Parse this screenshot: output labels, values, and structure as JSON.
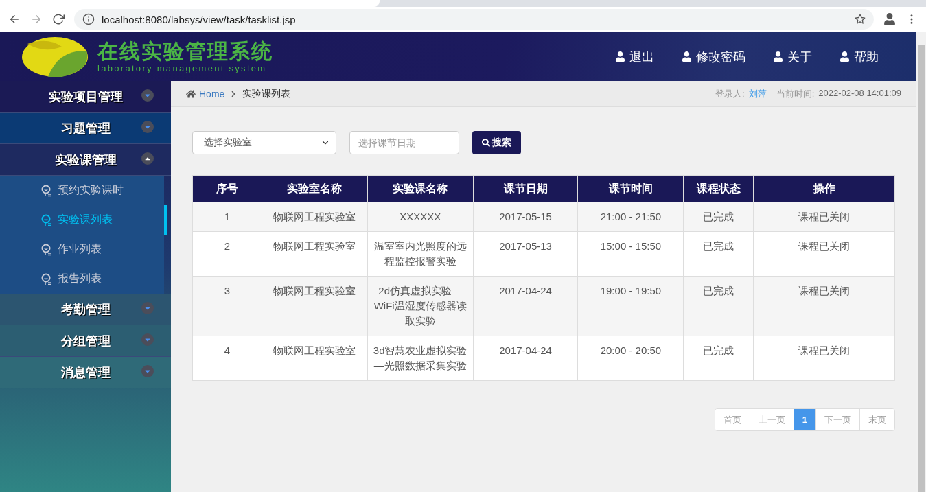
{
  "browser": {
    "url": "localhost:8080/labsys/view/task/tasklist.jsp"
  },
  "header": {
    "logo_title": "在线实验管理系统",
    "logo_subtitle": "laboratory management system",
    "links": [
      {
        "label": "退出"
      },
      {
        "label": "修改密码"
      },
      {
        "label": "关于"
      },
      {
        "label": "帮助"
      }
    ]
  },
  "sidebar": {
    "groups": [
      {
        "label": "实验项目管理",
        "expanded": false
      },
      {
        "label": "习题管理",
        "expanded": false
      },
      {
        "label": "实验课管理",
        "expanded": true,
        "children": [
          {
            "label": "预约实验课时",
            "selected": false
          },
          {
            "label": "实验课列表",
            "selected": true
          },
          {
            "label": "作业列表",
            "selected": false
          },
          {
            "label": "报告列表",
            "selected": false
          }
        ]
      },
      {
        "label": "考勤管理",
        "expanded": false
      },
      {
        "label": "分组管理",
        "expanded": false
      },
      {
        "label": "消息管理",
        "expanded": false
      }
    ]
  },
  "breadcrumb": {
    "home": "Home",
    "current": "实验课列表",
    "user_label": "登录人:",
    "user": "刘萍",
    "time_label": "当前时间:",
    "time": "2022-02-08 14:01:09"
  },
  "filters": {
    "lab_select": "选择实验室",
    "date_placeholder": "选择课节日期",
    "search_button": "搜索"
  },
  "table": {
    "columns": [
      "序号",
      "实验室名称",
      "实验课名称",
      "课节日期",
      "课节时间",
      "课程状态",
      "操作"
    ],
    "rows": [
      [
        "1",
        "物联网工程实验室",
        "XXXXXX",
        "2017-05-15",
        "21:00 - 21:50",
        "已完成",
        "课程已关闭"
      ],
      [
        "2",
        "物联网工程实验室",
        "温室室内光照度的远程监控报警实验",
        "2017-05-13",
        "15:00 - 15:50",
        "已完成",
        "课程已关闭"
      ],
      [
        "3",
        "物联网工程实验室",
        "2d仿真虚拟实验—WiFi温湿度传感器读取实验",
        "2017-04-24",
        "19:00 - 19:50",
        "已完成",
        "课程已关闭"
      ],
      [
        "4",
        "物联网工程实验室",
        "3d智慧农业虚拟实验—光照数据采集实验",
        "2017-04-24",
        "20:00 - 20:50",
        "已完成",
        "课程已关闭"
      ]
    ]
  },
  "pagination": [
    {
      "label": "首页",
      "selected": false
    },
    {
      "label": "上一页",
      "selected": false
    },
    {
      "label": "1",
      "selected": true
    },
    {
      "label": "下一页",
      "selected": false
    },
    {
      "label": "末页",
      "selected": false
    }
  ]
}
